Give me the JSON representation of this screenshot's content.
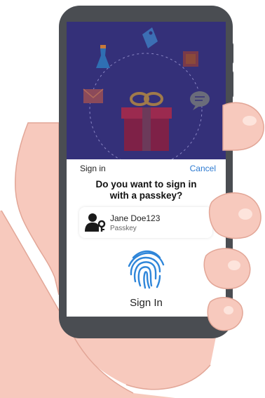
{
  "sheet": {
    "sign_in_label": "Sign in",
    "cancel_label": "Cancel",
    "prompt_line1": "Do you want to sign in",
    "prompt_line2": "with a passkey?",
    "account_name": "Jane Doe123",
    "account_type": "Passkey",
    "title": "Sign In"
  },
  "icons": {
    "account": "user-key-icon",
    "fingerprint": "fingerprint-icon",
    "hero": [
      "gift-icon",
      "dress-icon",
      "tag-icon",
      "box-icon",
      "envelope-icon",
      "chat-bubble-icon"
    ]
  },
  "colors": {
    "hero_background": "#343079",
    "accent": "#2e7bd1",
    "fingerprint": "#2f86d9",
    "phone_body": "#4a4d52",
    "skin": "#f7c9bd"
  }
}
